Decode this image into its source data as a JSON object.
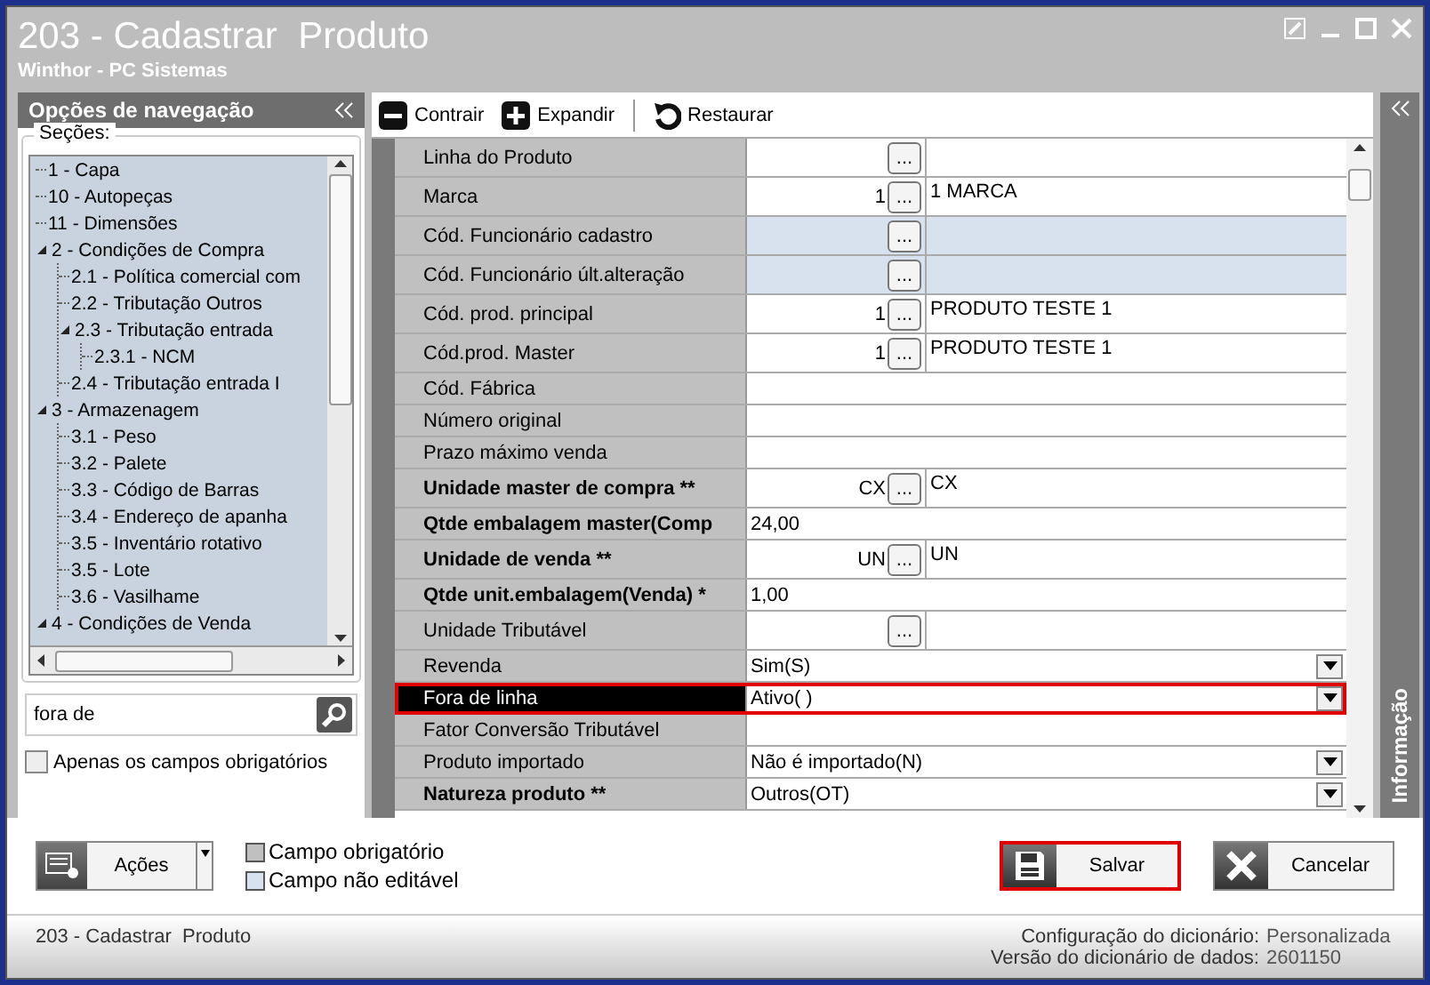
{
  "window": {
    "title": "203 - Cadastrar  Produto",
    "subtitle": "Winthor - PC Sistemas"
  },
  "navigation": {
    "title": "Opções de navegação",
    "group_label": "Seções:",
    "sections": [
      {
        "label": "1 - Capa"
      },
      {
        "label": "10 - Autopeças"
      },
      {
        "label": "11 - Dimensões"
      },
      {
        "label": "2 - Condições de Compra",
        "expanded": true,
        "children": [
          {
            "label": "2.1 - Política comercial com"
          },
          {
            "label": "2.2 - Tributação Outros"
          },
          {
            "label": "2.3 - Tributação entrada",
            "expanded": true,
            "children": [
              {
                "label": "2.3.1 - NCM"
              }
            ]
          },
          {
            "label": "2.4 - Tributação entrada I"
          }
        ]
      },
      {
        "label": "3 - Armazenagem",
        "expanded": true,
        "children": [
          {
            "label": "3.1 - Peso"
          },
          {
            "label": "3.2 - Palete"
          },
          {
            "label": "3.3 - Código de Barras"
          },
          {
            "label": "3.4 - Endereço de apanha"
          },
          {
            "label": "3.5 - Inventário rotativo"
          },
          {
            "label": "3.5 - Lote"
          },
          {
            "label": "3.6 - Vasilhame"
          }
        ]
      },
      {
        "label": "4 - Condições de Venda",
        "expanded": true
      }
    ],
    "search": {
      "value": "fora de"
    },
    "required_only": {
      "label": "Apenas os campos obrigatórios",
      "checked": false
    }
  },
  "toolbar": [
    "Contrair",
    "Expandir",
    "Restaurar"
  ],
  "rows": [
    {
      "label": "Linha do Produto",
      "kind": "lookup",
      "bold": false,
      "editable": true,
      "selected": false,
      "button": "..."
    },
    {
      "label": "Marca",
      "kind": "lookup",
      "bold": false,
      "editable": true,
      "selected": false,
      "code": "1",
      "button": "...",
      "description": "1 MARCA"
    },
    {
      "label": "Cód. Funcionário cadastro",
      "kind": "lookup",
      "bold": false,
      "editable": false,
      "selected": false,
      "button": "..."
    },
    {
      "label": "Cód. Funcionário últ.alteração",
      "kind": "lookup",
      "bold": false,
      "editable": false,
      "selected": false,
      "button": "..."
    },
    {
      "label": "Cód. prod. principal",
      "kind": "lookup",
      "bold": false,
      "editable": true,
      "selected": false,
      "code": "1",
      "button": "...",
      "description": "PRODUTO TESTE 1"
    },
    {
      "label": "Cód.prod. Master",
      "kind": "lookup",
      "bold": false,
      "editable": true,
      "selected": false,
      "code": "1",
      "button": "...",
      "description": "PRODUTO TESTE 1"
    },
    {
      "label": "Cód. Fábrica",
      "kind": "text",
      "bold": false,
      "editable": true,
      "selected": false
    },
    {
      "label": "Número original",
      "kind": "text",
      "bold": false,
      "editable": true,
      "selected": false
    },
    {
      "label": "Prazo máximo venda",
      "kind": "text",
      "bold": false,
      "editable": true,
      "selected": false
    },
    {
      "label": "Unidade master de compra **",
      "kind": "lookup",
      "bold": true,
      "editable": true,
      "selected": false,
      "code": "CX",
      "button": "...",
      "description": "CX"
    },
    {
      "label": "Qtde embalagem master(Comp",
      "kind": "text",
      "bold": true,
      "editable": true,
      "selected": false,
      "value": "24,00"
    },
    {
      "label": "Unidade de venda **",
      "kind": "lookup",
      "bold": true,
      "editable": true,
      "selected": false,
      "code": "UN",
      "button": "...",
      "description": "UN"
    },
    {
      "label": "Qtde unit.embalagem(Venda) *",
      "kind": "text",
      "bold": true,
      "editable": true,
      "selected": false,
      "value": "1,00"
    },
    {
      "label": "Unidade Tributável",
      "kind": "lookup",
      "bold": false,
      "editable": true,
      "selected": false,
      "button": "..."
    },
    {
      "label": "Revenda",
      "kind": "combo",
      "bold": false,
      "editable": true,
      "selected": false,
      "value": "Sim(S)"
    },
    {
      "label": "Fora de linha",
      "kind": "combo",
      "bold": false,
      "editable": true,
      "selected": true,
      "value": "Ativo( )"
    },
    {
      "label": "Fator Conversão Tributável",
      "kind": "text",
      "bold": false,
      "editable": true,
      "selected": false
    },
    {
      "label": "Produto importado",
      "kind": "combo",
      "bold": false,
      "editable": true,
      "selected": false,
      "value": "Não é importado(N)"
    },
    {
      "label": "Natureza produto **",
      "kind": "combo",
      "bold": true,
      "editable": true,
      "selected": false,
      "value": "Outros(OT)"
    }
  ],
  "side_panel": {
    "label": "Informação"
  },
  "actions_button": "Ações",
  "legend": [
    {
      "label": "Campo obrigatório",
      "color": "#c0c0c0"
    },
    {
      "label": "Campo não editável",
      "color": "#d8e2ee"
    }
  ],
  "buttons": [
    {
      "label": "Salvar",
      "kind": "save",
      "highlighted": true
    },
    {
      "label": "Cancelar",
      "kind": "cancel",
      "highlighted": false
    }
  ],
  "status_bar": {
    "left": "203 - Cadastrar  Produto",
    "items": [
      {
        "label": "Configuração do dicionário:",
        "value": "Personalizada"
      },
      {
        "label": "Versão do dicionário de dados:",
        "value": "2601150"
      }
    ]
  }
}
